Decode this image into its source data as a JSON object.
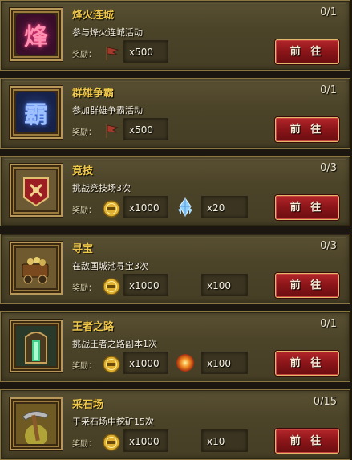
{
  "reward_label": "奖励：",
  "button_label": "前 往",
  "tasks": [
    {
      "title": "烽火连城",
      "progress": "0/1",
      "description": "参与烽火连城活动",
      "icon": "beacon-char-icon",
      "icon_glyph": "烽",
      "rewards": [
        {
          "icon": "battle-flag-icon",
          "amount": "x500"
        }
      ]
    },
    {
      "title": "群雄争霸",
      "progress": "0/1",
      "description": "参加群雄争霸活动",
      "icon": "hegemony-char-icon",
      "icon_glyph": "霸",
      "rewards": [
        {
          "icon": "battle-flag-icon",
          "amount": "x500"
        }
      ]
    },
    {
      "title": "竞技",
      "progress": "0/3",
      "description": "挑战竞技场3次",
      "icon": "arena-banner-icon",
      "icon_glyph": "",
      "rewards": [
        {
          "icon": "exp-coin-icon",
          "amount": "x1000"
        },
        {
          "icon": "crystal-icon",
          "amount": "x20"
        }
      ]
    },
    {
      "title": "寻宝",
      "progress": "0/3",
      "description": "在敌国城池寻宝3次",
      "icon": "treasure-cart-icon",
      "icon_glyph": "",
      "rewards": [
        {
          "icon": "exp-coin-icon",
          "amount": "x1000"
        },
        {
          "icon": "",
          "amount": "x100"
        }
      ]
    },
    {
      "title": "王者之路",
      "progress": "0/1",
      "description": "挑战王者之路副本1次",
      "icon": "kings-gate-icon",
      "icon_glyph": "",
      "rewards": [
        {
          "icon": "exp-coin-icon",
          "amount": "x1000"
        },
        {
          "icon": "fire-orb-icon",
          "amount": "x100"
        }
      ]
    },
    {
      "title": "采石场",
      "progress": "0/15",
      "description": "于采石场中挖矿15次",
      "icon": "pickaxe-icon",
      "icon_glyph": "",
      "rewards": [
        {
          "icon": "exp-coin-icon",
          "amount": "x1000"
        },
        {
          "icon": "",
          "amount": "x10"
        }
      ]
    }
  ]
}
